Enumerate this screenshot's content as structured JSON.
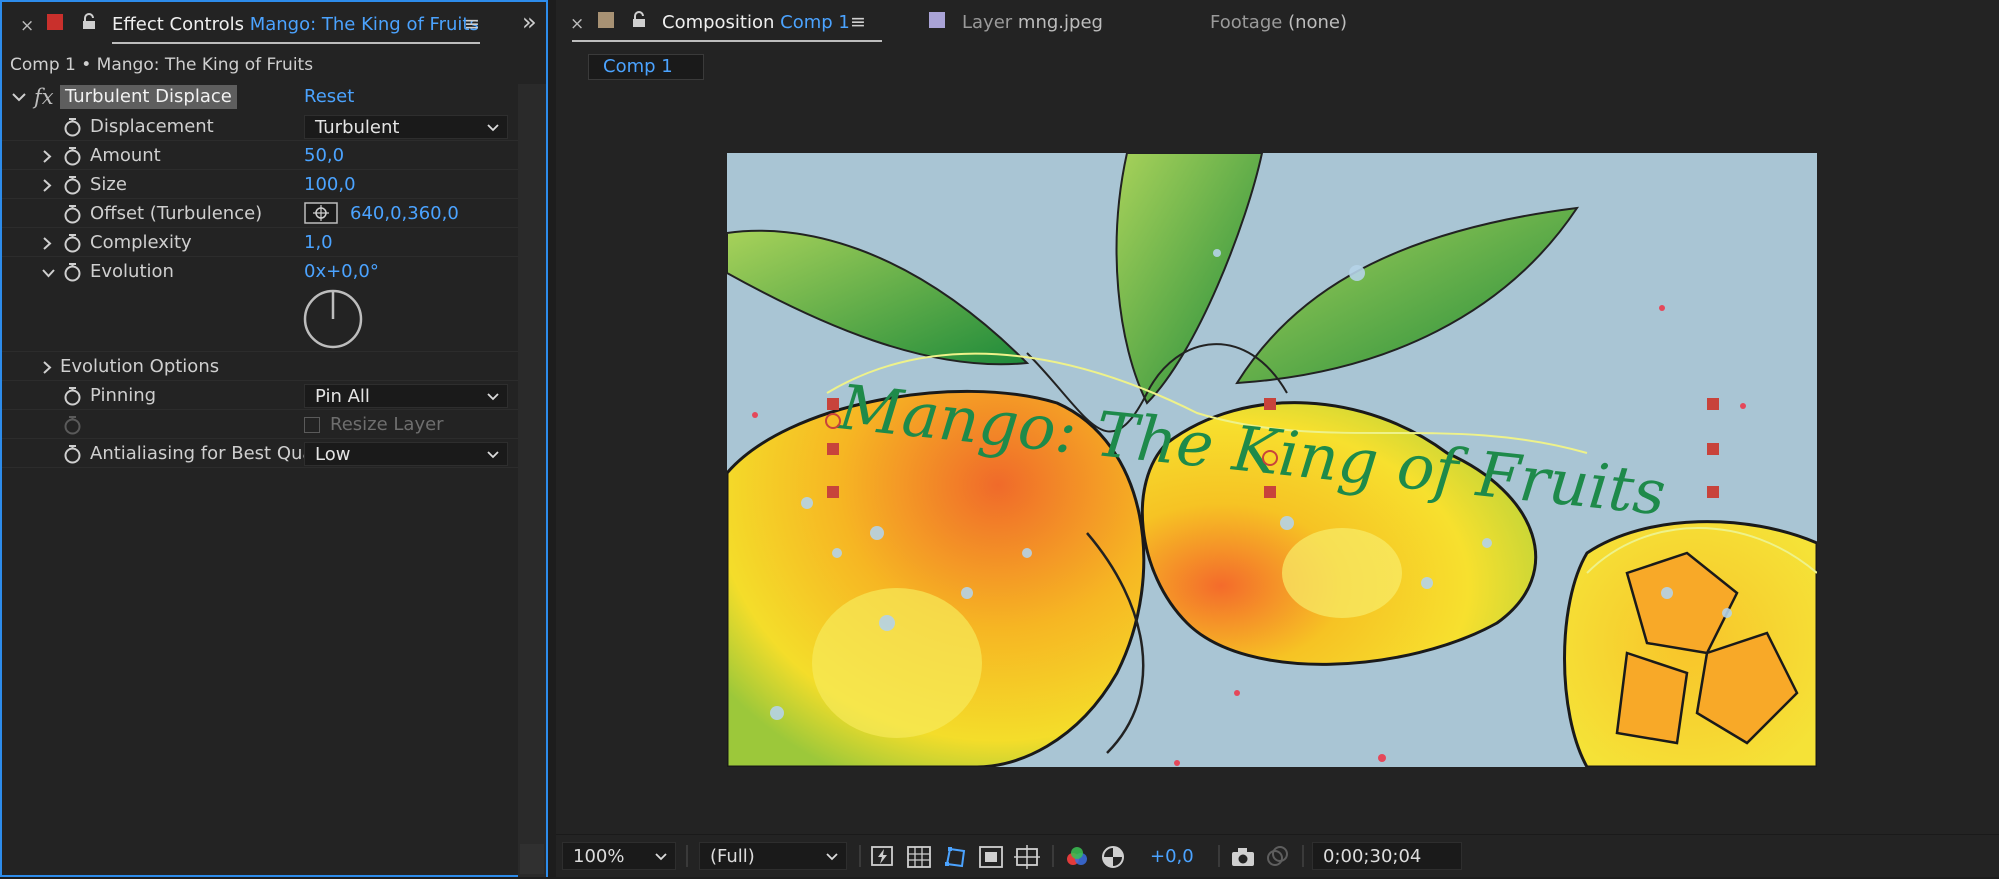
{
  "effect_controls": {
    "tab_close": "×",
    "tab_label": "Effect Controls",
    "tab_layer": "Mango: The King of Fruits",
    "tab_menu": "≡",
    "expand": "»",
    "subtitle": "Comp 1 • Mango: The King of Fruits",
    "effect": {
      "fx": "fx",
      "name": "Turbulent Displace",
      "reset": "Reset"
    },
    "properties": {
      "displacement": {
        "label": "Displacement",
        "value": "Turbulent"
      },
      "amount": {
        "label": "Amount",
        "value": "50,0"
      },
      "size": {
        "label": "Size",
        "value": "100,0"
      },
      "offset": {
        "label": "Offset (Turbulence)",
        "value": "640,0,360,0"
      },
      "complexity": {
        "label": "Complexity",
        "value": "1,0"
      },
      "evolution": {
        "label": "Evolution",
        "value": "0x+0,0°"
      },
      "evolution_options": {
        "label": "Evolution Options"
      },
      "pinning": {
        "label": "Pinning",
        "value": "Pin All"
      },
      "resize_layer": {
        "label": "Resize Layer"
      },
      "antialiasing": {
        "label": "Antialiasing for Best Qua",
        "value": "Low"
      }
    }
  },
  "composition": {
    "tab_close": "×",
    "tab_label": "Composition",
    "tab_comp": "Comp 1",
    "tab_menu": "≡",
    "layer_tab": {
      "prefix": "Layer",
      "name": "mng.jpeg"
    },
    "footage_tab": {
      "prefix": "Footage",
      "name": "(none)"
    },
    "subtab": "Comp 1",
    "title_text": "Mango: The King of Fruits",
    "bottom": {
      "zoom": "100%",
      "resolution": "(Full)",
      "exposure": "+0,0",
      "timecode": "0;00;30;04"
    }
  },
  "colors": {
    "accent_blue": "#4ba3ff",
    "panel_border": "#2d8ceb",
    "ec_label_swatch": "#c9302c",
    "comp_label_swatch": "#a89274",
    "layer_label_swatch": "#a9a3d6",
    "canvas_bg": "#a9c5d4",
    "title_green": "#1e8a4a"
  }
}
